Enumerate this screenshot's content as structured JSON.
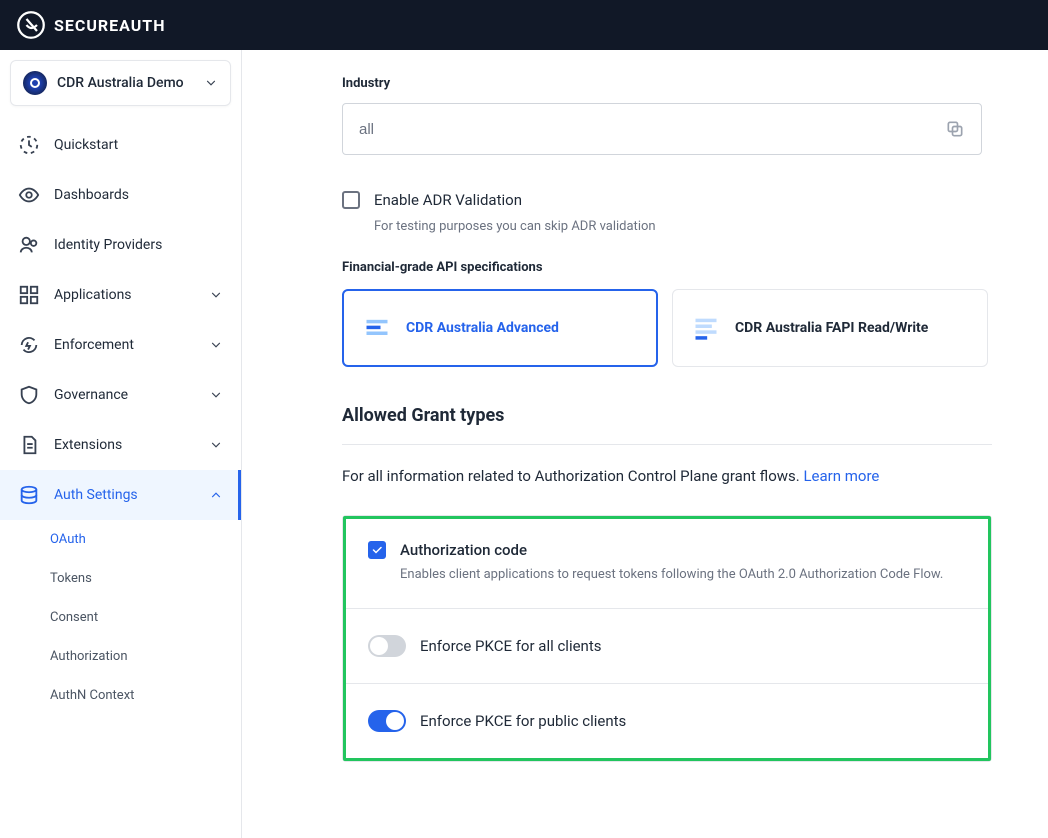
{
  "brand": "SECUREAUTH",
  "workspace": {
    "name": "CDR Australia Demo"
  },
  "sidebar": {
    "items": [
      "Quickstart",
      "Dashboards",
      "Identity Providers",
      "Applications",
      "Enforcement",
      "Governance",
      "Extensions",
      "Auth Settings"
    ],
    "sub": [
      "OAuth",
      "Tokens",
      "Consent",
      "Authorization",
      "AuthN Context"
    ]
  },
  "main": {
    "industry": {
      "label": "Industry",
      "value": "all"
    },
    "adr": {
      "label": "Enable ADR Validation",
      "helper": "For testing purposes you can skip ADR validation",
      "checked": false
    },
    "fapi": {
      "label": "Financial-grade API specifications",
      "options": [
        "CDR Australia Advanced",
        "CDR Australia FAPI Read/Write"
      ],
      "selected": 0
    },
    "grant": {
      "title": "Allowed Grant types",
      "info": "For all information related to Authorization Control Plane grant flows. ",
      "learn_more": "Learn more",
      "auth_code": {
        "title": "Authorization code",
        "desc": "Enables client applications to request tokens following the OAuth 2.0 Authorization Code Flow.",
        "checked": true
      },
      "pkce_all": "Enforce PKCE for all clients",
      "pkce_all_on": false,
      "pkce_public": "Enforce PKCE for public clients",
      "pkce_public_on": true
    }
  }
}
